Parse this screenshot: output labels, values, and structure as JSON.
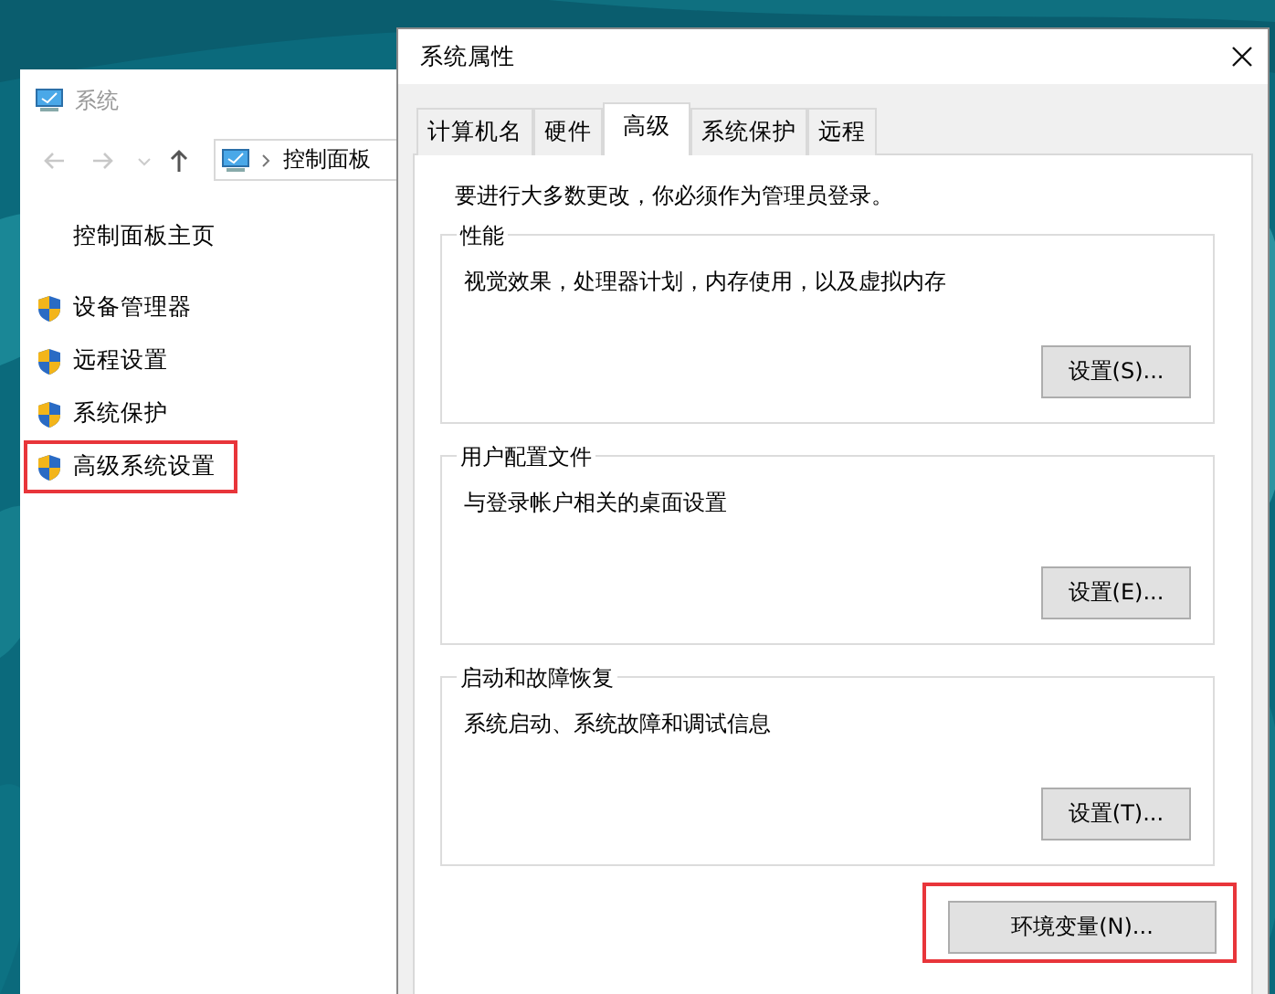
{
  "explorer": {
    "title": "系统",
    "breadcrumb": "控制面板",
    "home_link": "控制面板主页",
    "links": [
      {
        "label": "设备管理器",
        "highlighted": false
      },
      {
        "label": "远程设置",
        "highlighted": false
      },
      {
        "label": "系统保护",
        "highlighted": false
      },
      {
        "label": "高级系统设置",
        "highlighted": true
      }
    ]
  },
  "dialog": {
    "title": "系统属性",
    "tabs": [
      {
        "label": "计算机名",
        "selected": false
      },
      {
        "label": "硬件",
        "selected": false
      },
      {
        "label": "高级",
        "selected": true
      },
      {
        "label": "系统保护",
        "selected": false
      },
      {
        "label": "远程",
        "selected": false
      }
    ],
    "notice": "要进行大多数更改，你必须作为管理员登录。",
    "groups": [
      {
        "title": "性能",
        "description": "视觉效果，处理器计划，内存使用，以及虚拟内存",
        "button": "设置(S)..."
      },
      {
        "title": "用户配置文件",
        "description": "与登录帐户相关的桌面设置",
        "button": "设置(E)..."
      },
      {
        "title": "启动和故障恢复",
        "description": "系统启动、系统故障和调试信息",
        "button": "设置(T)..."
      }
    ],
    "env_button": {
      "label": "环境变量(N)...",
      "highlighted": true
    }
  }
}
